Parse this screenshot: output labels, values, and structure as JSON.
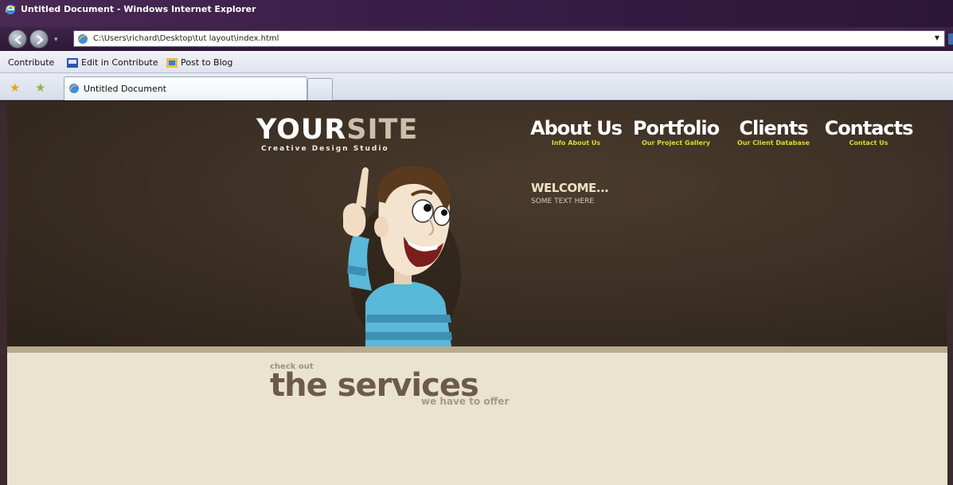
{
  "browser": {
    "title": "Untitled Document - Windows Internet Explorer",
    "url": "C:\\Users\\richard\\Desktop\\tut layout\\index.html",
    "links": [
      {
        "label": "Contribute",
        "icon": "none"
      },
      {
        "label": "Edit in Contribute",
        "icon": "contribute-edit-icon"
      },
      {
        "label": "Post to Blog",
        "icon": "blog-post-icon"
      }
    ],
    "tab_title": "Untitled Document",
    "colors": {
      "titlebar": "#3a1e48",
      "tab": "#ffffff"
    }
  },
  "site": {
    "logo": {
      "main_a": "YOUR",
      "main_b": "SITE",
      "tagline": "Creative Design Studio"
    },
    "nav": [
      {
        "title": "About Us",
        "sub": "Info About Us"
      },
      {
        "title": "Portfolio",
        "sub": "Our Project Gallery"
      },
      {
        "title": "Clients",
        "sub": "Our Client Database"
      },
      {
        "title": "Contacts",
        "sub": "Contact Us"
      }
    ],
    "welcome": {
      "title": "WELCOME...",
      "text": "SOME TEXT HERE"
    },
    "services": {
      "small": "check out",
      "main": "the services",
      "tail": "we have to offer"
    },
    "colors": {
      "hero_bg": "#3a2e23",
      "content_bg": "#eae3cf",
      "nav_sub": "#d7dc2e"
    }
  }
}
